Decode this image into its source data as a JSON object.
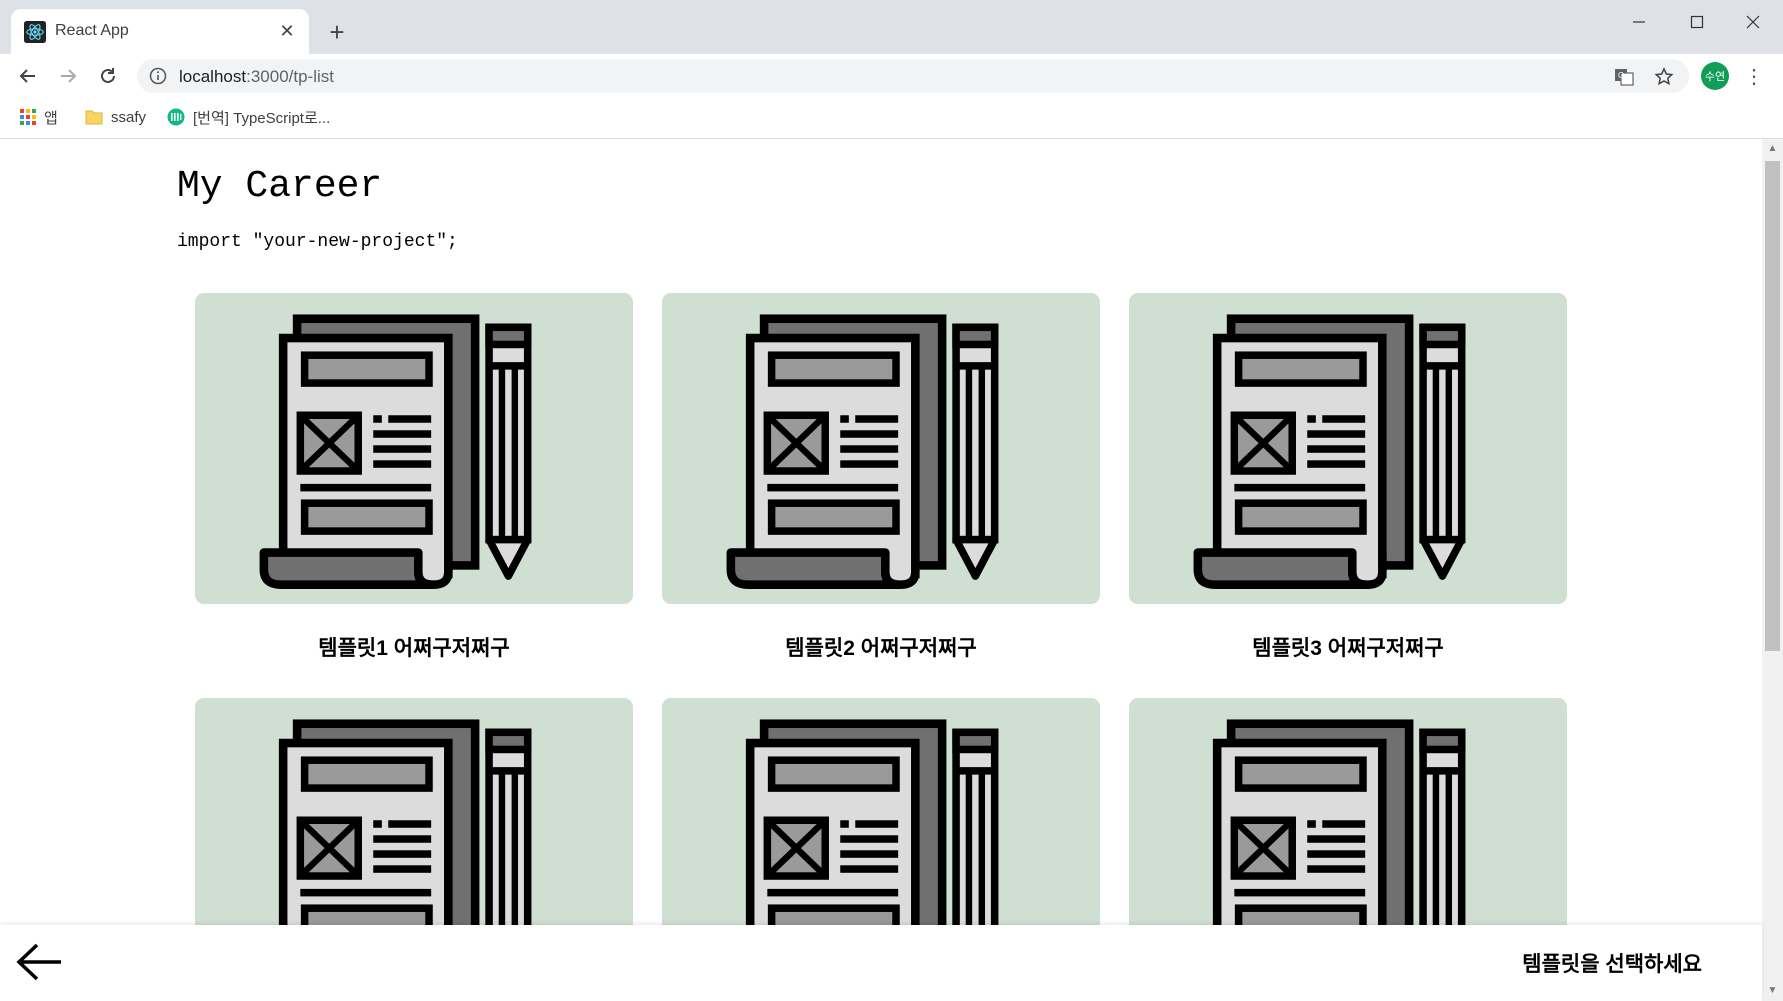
{
  "browser": {
    "tab_title": "React App",
    "url_host": "localhost",
    "url_rest": ":3000/tp-list",
    "profile_initials": "수연",
    "bookmarks": [
      {
        "label": "앱",
        "icon": "apps-grid-icon"
      },
      {
        "label": "ssafy",
        "icon": "folder-icon"
      },
      {
        "label": "[번역] TypeScript로...",
        "icon": "site-favicon-icon"
      }
    ]
  },
  "page": {
    "title": "My Career",
    "subtitle": "import \"your-new-project\";",
    "cards": [
      {
        "label": "템플릿1 어쩌구저쩌구",
        "icon": "document-pencil-icon"
      },
      {
        "label": "템플릿2 어쩌구저쩌구",
        "icon": "document-pencil-icon"
      },
      {
        "label": "템플릿3 어쩌구저쩌구",
        "icon": "document-pencil-icon"
      },
      {
        "label": "",
        "icon": "document-pencil-icon"
      },
      {
        "label": "",
        "icon": "document-pencil-icon"
      },
      {
        "label": "",
        "icon": "document-pencil-icon"
      }
    ],
    "card_bg_color": "#cfdfd2"
  },
  "bottom_bar": {
    "message": "템플릿을 선택하세요"
  }
}
